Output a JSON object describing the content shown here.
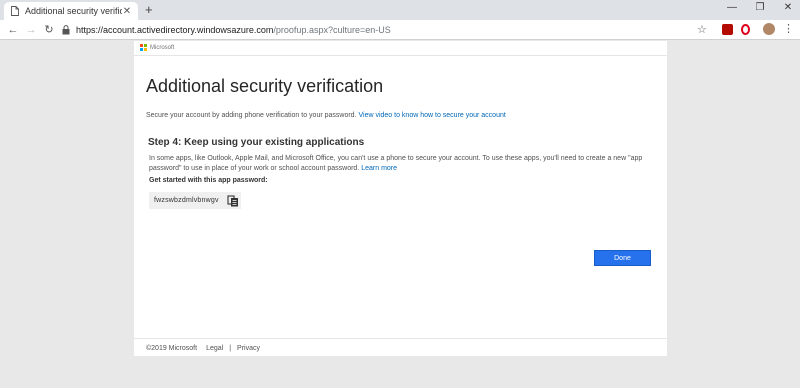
{
  "browser": {
    "tab_title": "Additional security verification",
    "tab_close": "✕",
    "new_tab": "+",
    "window_controls": {
      "minimize": "—",
      "restore": "❐",
      "close": "✕"
    },
    "nav": {
      "back": "←",
      "forward": "→",
      "reload": "↻"
    },
    "url_host": "https://account.activedirectory.windowsazure.com",
    "url_path": "/proofup.aspx?culture=en-US",
    "bookmark": "☆",
    "menu": "⋮"
  },
  "page": {
    "brand": "Microsoft",
    "brand_colors": [
      "#f25022",
      "#7fba00",
      "#00a4ef",
      "#ffb900"
    ],
    "title": "Additional security verification",
    "intro_text": "Secure your account by adding phone verification to your password.",
    "intro_link": "View video to know how to secure your account",
    "step_title": "Step 4: Keep using your existing applications",
    "step_text": "In some apps, like Outlook, Apple Mail, and Microsoft Office, you can't use a phone to secure your account. To use these apps, you'll need to create a new \"app password\" to use in place of your work or school account password.",
    "learn_more": "Learn more",
    "get_started_label": "Get started with this app password:",
    "app_password": "fwzswbzdmlvbnwgv",
    "done_button": "Done",
    "accent_color": "#2672ec"
  },
  "footer": {
    "copyright": "©2019 Microsoft",
    "legal": "Legal",
    "separator": "|",
    "privacy": "Privacy"
  }
}
